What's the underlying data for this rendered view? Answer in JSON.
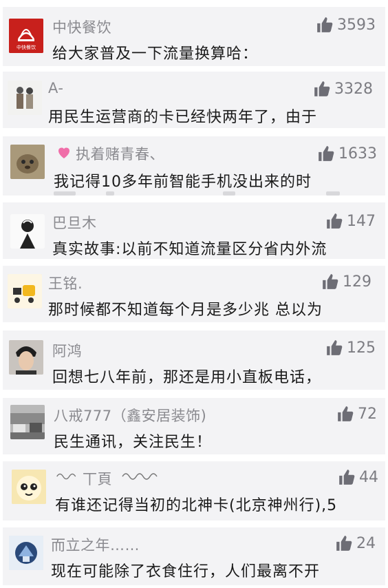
{
  "comments": [
    {
      "name": "中快餐饮",
      "likes": "3593",
      "text": "给大家普及一下流量换算哈："
    },
    {
      "name": "A-",
      "likes": "3328",
      "text": "用民生运营商的卡已经快两年了，由于"
    },
    {
      "name": "执着赌青春、",
      "likes": "1633",
      "text": "我记得10多年前智能手机没出来的时"
    },
    {
      "name": "巴旦木",
      "likes": "147",
      "text": "真实故事:以前不知道流量区分省内外流"
    },
    {
      "name": "王铭.",
      "likes": "129",
      "text": "那时候都不知道每个月是多少兆 总以为"
    },
    {
      "name": "阿鸿",
      "likes": "125",
      "text": "回想七八年前，那还是用小直板电话，"
    },
    {
      "name": "八戒777（鑫安居装饰)",
      "likes": "72",
      "text": "民生通讯，关注民生！"
    },
    {
      "name": "丅頁",
      "likes": "44",
      "text": "有谁还记得当初的北神卡(北京神州行),5"
    },
    {
      "name": "而立之年……",
      "likes": "24",
      "text": "现在可能除了衣食住行，人们最离不开"
    }
  ],
  "avatar_labels": {
    "c0": "中快餐饮"
  },
  "icons": {
    "like": "thumbs-up-icon",
    "heart": "heart-icon"
  },
  "colors": {
    "like_icon": "#6d6d75",
    "name": "#8a8a8f",
    "text": "#1a1a1a",
    "card_bg": "#f3f3f5"
  }
}
